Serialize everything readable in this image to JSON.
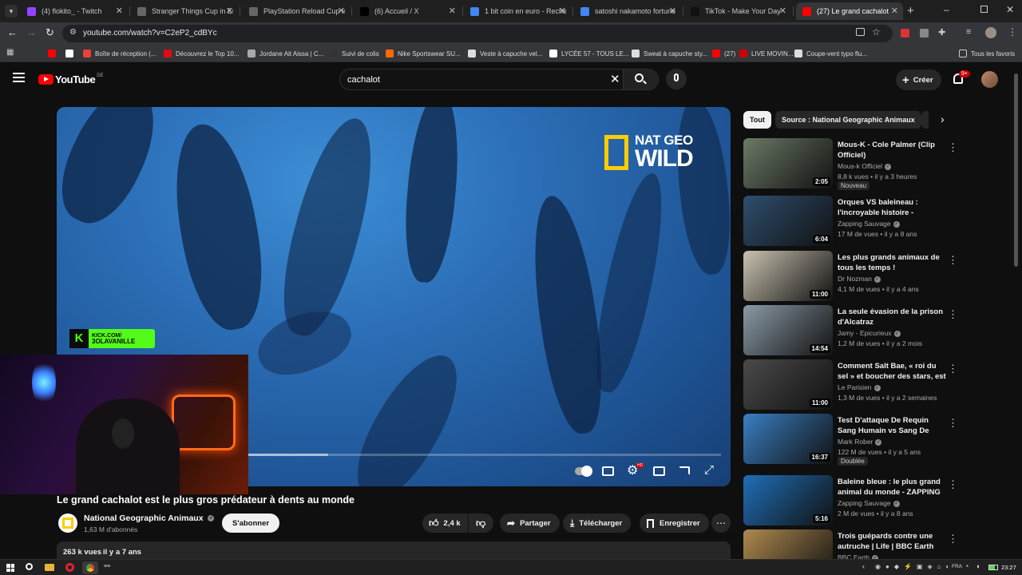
{
  "browser": {
    "tabs": [
      {
        "label": "(4) flokito_ - Twitch",
        "color": "#9146ff"
      },
      {
        "label": "Stranger Things Cup in Eu",
        "color": "#666666"
      },
      {
        "label": "PlayStation Reload Cup in",
        "color": "#666666"
      },
      {
        "label": "(6) Accueil / X",
        "color": "#000000"
      },
      {
        "label": "1 bit coin en euro - Reche",
        "color": "#4285f4"
      },
      {
        "label": "satoshi nakamoto fortune",
        "color": "#4285f4"
      },
      {
        "label": "TikTok - Make Your Day",
        "color": "#111111"
      },
      {
        "label": "(27) Le grand cachalot",
        "color": "#ff0000"
      }
    ],
    "url": "youtube.com/watch?v=C2eP2_cdBYc",
    "bookmarks": [
      {
        "label": "",
        "color": "#ff0000"
      },
      {
        "label": "",
        "color": "#ffffff"
      },
      {
        "label": "Boîte de réception (...",
        "color": "#ea4335"
      },
      {
        "label": "Découvrez le Top 10...",
        "color": "#e50914"
      },
      {
        "label": "Jordane Ait Aissa | C...",
        "color": "#aaaaaa"
      },
      {
        "label": "Suivi de colis",
        "color": "#333333"
      },
      {
        "label": "Nike Sportswear SU...",
        "color": "#ff6a00"
      },
      {
        "label": "Veste à capuche vel...",
        "color": "#dddddd"
      },
      {
        "label": "LYCÉE 57 - TOUS LE...",
        "color": "#ffffff"
      },
      {
        "label": "Sweat à capuche sty...",
        "color": "#dddddd"
      },
      {
        "label": "(27)",
        "color": "#ff0000"
      },
      {
        "label": "LIVE MOVIN...",
        "color": "#cc0000"
      },
      {
        "label": "Coupe-vent typo flu...",
        "color": "#dddddd"
      }
    ],
    "all_bookmarks_label": "Tous les favoris"
  },
  "youtube": {
    "logo_text": "YouTube",
    "logo_region": "DE",
    "search_query": "cachalot",
    "create_label": "Créer",
    "notif_count": "9+"
  },
  "video": {
    "title": "Le grand cachalot est le plus gros prédateur à dents au monde",
    "channel": "National Geographic Animaux",
    "subscribers": "1,63 M d'abonnés",
    "subscribe_label": "S'abonner",
    "likes": "2,4 k",
    "share_label": "Partager",
    "download_label": "Télécharger",
    "save_label": "Enregistrer",
    "views": "263 k vues",
    "age": "il y a 7 ans",
    "watermark_line1": "NAT GEO",
    "watermark_line2": "WILD",
    "kick_line1": "KICK.COM/",
    "kick_line2": "3OLAVANILLE",
    "progress_fraction": 0.4
  },
  "sidebar": {
    "chips": [
      {
        "label": "Tout",
        "active": true
      },
      {
        "label": "Source : National Geographic Animaux",
        "active": false
      }
    ],
    "recommendations": [
      {
        "title": "Mous-K - Cole Palmer (Clip Officiel)",
        "channel": "Mous-k Officiel",
        "views": "8,8 k vues",
        "age": "il y a 3 heures",
        "duration": "2:05",
        "badge": "Nouveau",
        "thumb": "#6b7a66"
      },
      {
        "title": "Orques VS baleineau : l'incroyable histoire - ZAPPING...",
        "channel": "Zapping Sauvage",
        "views": "17 M de vues",
        "age": "il y a 8 ans",
        "duration": "6:04",
        "badge": "",
        "thumb": "#2f4e6e"
      },
      {
        "title": "Les plus grands animaux de tous les temps !",
        "channel": "Dr Nozman",
        "views": "4,1 M de vues",
        "age": "il y a 4 ans",
        "duration": "11:00",
        "badge": "",
        "thumb": "#c9c2b0"
      },
      {
        "title": "La seule évasion de la prison d'Alcatraz",
        "channel": "Jamy - Epicurieux",
        "views": "1,2 M de vues",
        "age": "il y a 2 mois",
        "duration": "14:54",
        "badge": "",
        "thumb": "#8a9aa6"
      },
      {
        "title": "Comment Salt Bae, « roi du sel » et boucher des stars, est tomb...",
        "channel": "Le Parisien",
        "views": "1,3 M de vues",
        "age": "il y a 2 semaines",
        "duration": "11:00",
        "badge": "",
        "thumb": "#4a4a4a"
      },
      {
        "title": "Test D'attaque De Requin Sang Humain vs Sang De Poisson",
        "channel": "Mark Rober",
        "views": "122 M de vues",
        "age": "il y a 5 ans",
        "duration": "16:37",
        "badge": "Doublée",
        "thumb": "#3a7fc4"
      },
      {
        "title": "Baleine bleue : le plus grand animal du monde - ZAPPING ...",
        "channel": "Zapping Sauvage",
        "views": "2 M de vues",
        "age": "il y a 8 ans",
        "duration": "5:16",
        "badge": "",
        "thumb": "#1f6fb8"
      },
      {
        "title": "Trois guépards contre une autruche | Life | BBC Earth",
        "channel": "BBC Earth",
        "views": "",
        "age": "",
        "duration": "",
        "badge": "",
        "thumb": "#b08a50"
      }
    ]
  },
  "taskbar": {
    "lang": "FRA",
    "time": "23:27"
  }
}
